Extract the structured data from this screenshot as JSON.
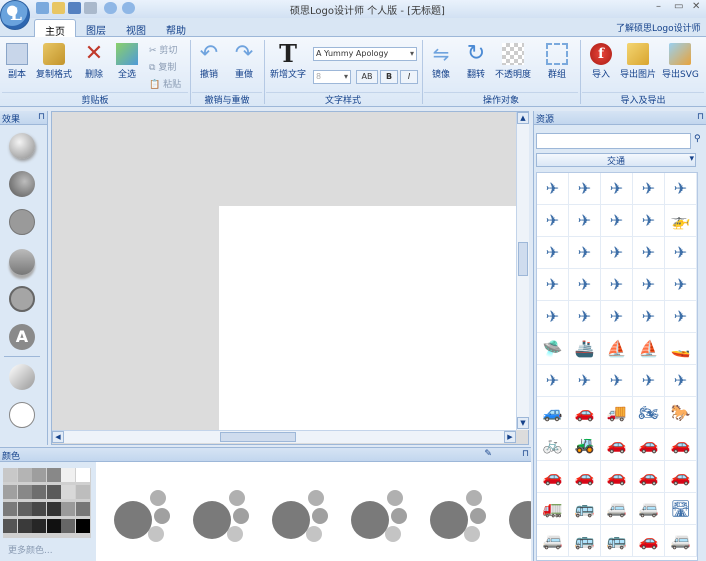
{
  "window": {
    "title": "硕思Logo设计师 个人版 - [无标题]",
    "minimize": "–",
    "maximize": "▭",
    "close": "✕"
  },
  "tabs": [
    {
      "label": "主页",
      "active": true
    },
    {
      "label": "图层"
    },
    {
      "label": "视图"
    },
    {
      "label": "帮助"
    }
  ],
  "about_link": "了解硕思Logo设计师",
  "ribbon": {
    "clipboard": {
      "group": "剪贴板",
      "copy": "副本",
      "format_painter": "复制格式",
      "delete": "删除",
      "select_all": "全选",
      "cut": "剪切",
      "copy_small": "复制",
      "paste": "粘贴"
    },
    "undo": {
      "group": "撤销与重做",
      "undo": "撤销",
      "redo": "重做"
    },
    "text": {
      "group": "文字样式",
      "new_text": "新增文字",
      "font": "A Yummy Apology",
      "size": "8",
      "bold": "B",
      "italic": "I",
      "effect": "AB"
    },
    "ops": {
      "group": "操作对象",
      "mirror": "镜像",
      "rotate": "翻转",
      "opacity": "不透明度",
      "group_btn": "群组"
    },
    "io": {
      "group": "导入及导出",
      "import": "导入",
      "export_img": "导出图片",
      "export_svg": "导出SVG"
    }
  },
  "left_panel": {
    "title": "效果",
    "pin": "⊓",
    "text_effect_glyph": "A"
  },
  "right_panel": {
    "title": "资源",
    "pin": "⊓",
    "category": "交通",
    "search_icon": "🔍"
  },
  "bottom_panel": {
    "title": "颜色",
    "pin": "⊓",
    "more_colors": "更多颜色..."
  },
  "colors": {
    "accent": "#15428b",
    "panel": "#dce8f5",
    "icon": "#3e6fa8"
  },
  "resource_icons": [
    "✈",
    "✈",
    "✈",
    "✈",
    "✈",
    "✈",
    "✈",
    "✈",
    "✈",
    "🚁",
    "✈",
    "✈",
    "✈",
    "✈",
    "✈",
    "✈",
    "✈",
    "✈",
    "✈",
    "✈",
    "✈",
    "✈",
    "✈",
    "✈",
    "✈",
    "🛸",
    "🚢",
    "⛵",
    "⛵",
    "🚤",
    "✈",
    "✈",
    "✈",
    "✈",
    "✈",
    "🚙",
    "🚗",
    "🚚",
    "🏍",
    "🐎",
    "🚲",
    "🚜",
    "🚗",
    "🚗",
    "🚗",
    "🚗",
    "🚗",
    "🚗",
    "🚗",
    "🚗",
    "🚛",
    "🚌",
    "🚐",
    "🚐",
    "🛣",
    "🚐",
    "🚌",
    "🚌",
    "🚗",
    "🚐"
  ]
}
